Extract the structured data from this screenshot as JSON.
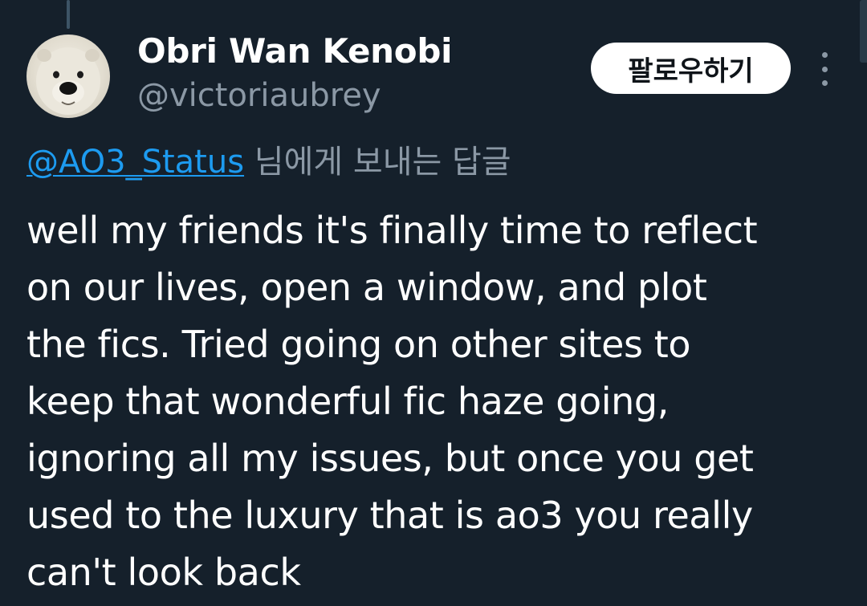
{
  "author": {
    "display_name": "Obri Wan Kenobi",
    "handle": "@victoriaubrey",
    "avatar_icon": "polar-bear-avatar"
  },
  "actions": {
    "follow_label": "팔로우하기",
    "more_icon": "more-vertical-icon"
  },
  "reply_context": {
    "mention": "@AO3_Status",
    "suffix": " 님에게 보내는 답글"
  },
  "tweet": {
    "lines": [
      "well my friends it's finally time to reflect",
      "on our lives, open a window, and plot",
      "the fics. Tried going on other sites to",
      "keep that wonderful fic haze going,",
      "ignoring all my issues, but once you get",
      "used to the luxury that is ao3 you really",
      "can't look back"
    ]
  },
  "colors": {
    "background": "#15202b",
    "text_primary": "#ffffff",
    "text_secondary": "#8b98a5",
    "link": "#1d9bf0",
    "button_bg": "#ffffff",
    "button_text": "#0f1419"
  }
}
